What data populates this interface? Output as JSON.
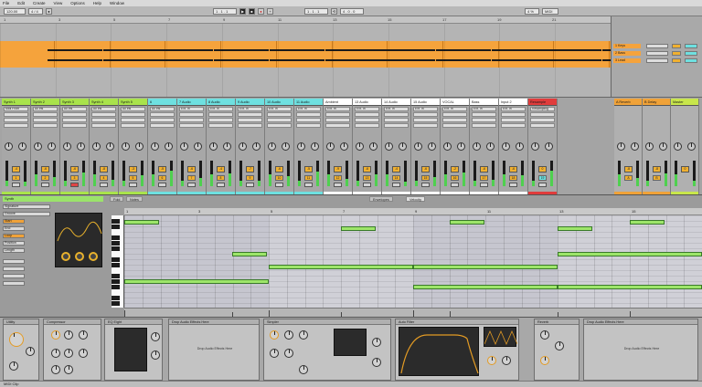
{
  "menu": [
    "File",
    "Edit",
    "Create",
    "View",
    "Options",
    "Help",
    "Window"
  ],
  "transport": {
    "tempo": "120.00",
    "signature": "4 / 4",
    "position": "1 . 1 . 1",
    "loop_start": "1 . 1 . 1",
    "loop_length": "4 . 0 . 0",
    "cpu": "4 %",
    "midi": "MIDI"
  },
  "arrangement": {
    "ruler": [
      "1",
      "3",
      "5",
      "7",
      "9",
      "11",
      "13",
      "15",
      "17",
      "19",
      "21"
    ],
    "track_names": [
      "1 Keys",
      "2 Bass",
      "3 Lead"
    ]
  },
  "mixer": {
    "tracks": [
      {
        "name": "Synth 1",
        "color": "#a9e34b",
        "slot": "Midi From",
        "vol": "-4",
        "num": "1"
      },
      {
        "name": "Synth 2",
        "color": "#a9e34b",
        "slot": "All Ins",
        "vol": "-6",
        "num": "2"
      },
      {
        "name": "Synth 3",
        "color": "#a9e34b",
        "slot": "All Ins",
        "vol": "-6",
        "num": "3"
      },
      {
        "name": "Synth 4",
        "color": "#a9e34b",
        "slot": "All Ins",
        "vol": "-8",
        "num": "4"
      },
      {
        "name": "Synth 5",
        "color": "#a9e34b",
        "slot": "All Ins",
        "vol": "-3",
        "num": "5"
      },
      {
        "name": "6",
        "color": "#6ee0e0",
        "slot": "All Ins",
        "vol": "-5",
        "num": "6"
      },
      {
        "name": "7 Audio",
        "color": "#6ee0e0",
        "slot": "Ext. In",
        "vol": "-6",
        "num": "7"
      },
      {
        "name": "8 Audio",
        "color": "#6ee0e0",
        "slot": "Ext. In",
        "vol": "-4",
        "num": "8"
      },
      {
        "name": "9 Audio",
        "color": "#6ee0e0",
        "slot": "Ext. In",
        "vol": "-7",
        "num": "9"
      },
      {
        "name": "10 Audio",
        "color": "#6ee0e0",
        "slot": "Ext. In",
        "vol": "-6",
        "num": "10"
      },
      {
        "name": "11 Audio",
        "color": "#6ee0e0",
        "slot": "Ext. In",
        "vol": "-5",
        "num": "11"
      },
      {
        "name": "Ambient",
        "color": "#ffffff",
        "slot": "Ext. In",
        "vol": "-9",
        "num": "12"
      },
      {
        "name": "13 Audio",
        "color": "#ffffff",
        "slot": "Ext. In",
        "vol": "-6",
        "num": "13"
      },
      {
        "name": "14 Audio",
        "color": "#ffffff",
        "slot": "Ext. In",
        "vol": "-4",
        "num": "14"
      },
      {
        "name": "15 Audio",
        "color": "#ffffff",
        "slot": "Ext. In",
        "vol": "-6",
        "num": "15"
      },
      {
        "name": "VOCAL",
        "color": "#ffffff",
        "slot": "Ext. In",
        "vol": "-2",
        "num": "16"
      },
      {
        "name": "Bass",
        "color": "#ffffff",
        "slot": "Ext. In",
        "vol": "-6",
        "num": "17"
      },
      {
        "name": "Input 2",
        "color": "#ffffff",
        "slot": "Ext. In",
        "vol": "-6",
        "num": "18"
      },
      {
        "name": "Resample",
        "color": "#e03c3c",
        "slot": "Resampling",
        "vol": "0",
        "num": "19"
      },
      {
        "name": "A Reverb",
        "color": "#f0a238",
        "slot": "",
        "vol": "-8",
        "num": "A"
      },
      {
        "name": "B Delay",
        "color": "#f0a238",
        "slot": "",
        "vol": "-8",
        "num": "B"
      },
      {
        "name": "Master",
        "color": "#c8e64b",
        "slot": "",
        "vol": "0",
        "num": ""
      }
    ]
  },
  "clip": {
    "name": "Synth",
    "props": [
      "Signature",
      "Groove",
      "Start",
      "End",
      "Loop",
      "Position",
      "Length"
    ],
    "tabs": [
      "Fold",
      "Notes",
      "Envelopes",
      "Velocity"
    ]
  },
  "devices": [
    {
      "name": "Utility"
    },
    {
      "name": "Compressor"
    },
    {
      "name": "EQ Eight"
    },
    {
      "name": "Drop Audio Effects Here"
    },
    {
      "name": "Simpler"
    },
    {
      "name": "Auto Filter"
    },
    {
      "name": "Reverb"
    },
    {
      "name": "Drop Audio Effects Here"
    }
  ],
  "status": "MIDI Clip",
  "colors": {
    "arrangement_clip": "#f5a33c",
    "note": "#9de56a",
    "knob_accent": "#e39b24"
  }
}
